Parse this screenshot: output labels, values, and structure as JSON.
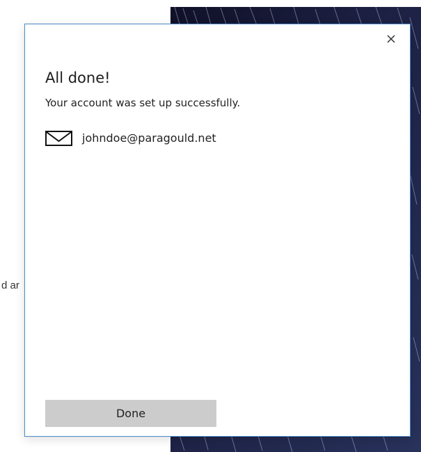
{
  "background": {
    "partial_text": "d ar"
  },
  "dialog": {
    "title": "All done!",
    "message": "Your account was set up successfully.",
    "account": {
      "email": "johndoe@paragould.net",
      "icon": "mail-icon"
    },
    "close_icon": "close-icon",
    "done_label": "Done"
  },
  "colors": {
    "dialog_border": "#4d8fcf",
    "done_button_background": "#cccccc",
    "wallpaper_background": "#171a34"
  }
}
